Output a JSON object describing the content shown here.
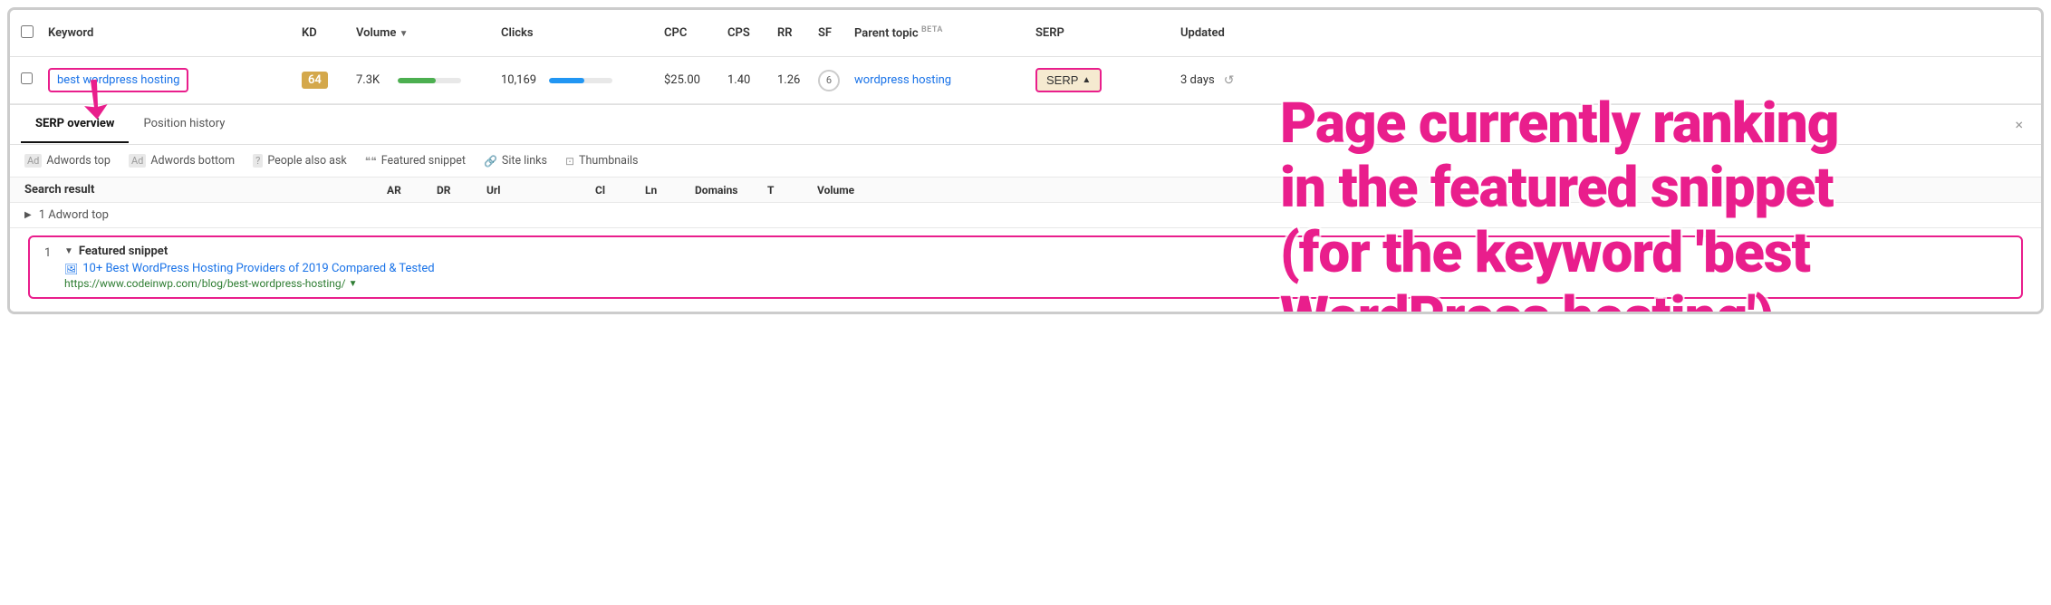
{
  "header": {
    "columns": {
      "keyword": "Keyword",
      "kd": "KD",
      "volume": "Volume",
      "clicks": "Clicks",
      "cpc": "CPC",
      "cps": "CPS",
      "rr": "RR",
      "sf": "SF",
      "parent_topic": "Parent topic",
      "parent_topic_beta": "BETA",
      "serp": "SERP",
      "updated": "Updated"
    }
  },
  "row": {
    "keyword": "best wordpress hosting",
    "kd": "64",
    "volume": "7.3K",
    "volume_pct": 60,
    "clicks": "10,169",
    "clicks_pct": 55,
    "cpc": "$25.00",
    "cps": "1.40",
    "rr": "1.26",
    "sf": "6",
    "parent_topic": "wordpress hosting",
    "serp_label": "SERP",
    "serp_arrow": "▲",
    "updated": "3 days"
  },
  "serp_panel": {
    "tab_overview": "SERP overview",
    "tab_position": "Position history",
    "close_label": "×"
  },
  "filters": [
    {
      "icon": "Ad",
      "label": "Adwords top"
    },
    {
      "icon": "Ad",
      "label": "Adwords bottom"
    },
    {
      "icon": "?",
      "label": "People also ask"
    },
    {
      "icon": "❞❞",
      "label": "Featured snippet"
    },
    {
      "icon": "🔗",
      "label": "Site links"
    },
    {
      "icon": "⊡",
      "label": "Thumbnails"
    }
  ],
  "results_header": {
    "search_result": "Search result",
    "ar": "AR",
    "dr": "DR",
    "url": "Url",
    "cl": "Cl",
    "ln": "Ln",
    "domains": "Domains",
    "t": "T",
    "volume": "Volume"
  },
  "adword_section": {
    "label": "1 Adword top"
  },
  "featured_snippet": {
    "row_number": "1",
    "label": "Featured snippet",
    "link_text": "10+ Best WordPress Hosting Providers of 2019 Compared & Tested",
    "url": "https://www.codeinwp.com/blog/best-wordpress-hosting/"
  },
  "annotation": {
    "text": "Page currently ranking\nin the featured snippet\n(for the keyword 'best\nWordPress hosting')"
  }
}
